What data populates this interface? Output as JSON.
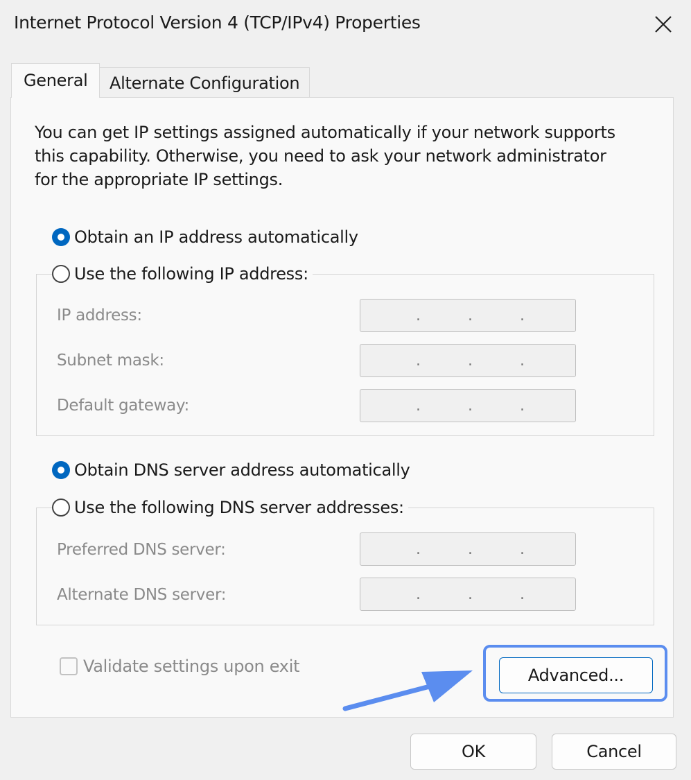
{
  "window": {
    "title": "Internet Protocol Version 4 (TCP/IPv4) Properties",
    "close_icon": "close-icon"
  },
  "tabs": [
    {
      "label": "General",
      "selected": true
    },
    {
      "label": "Alternate Configuration",
      "selected": false
    }
  ],
  "description": [
    "You can get IP settings assigned automatically if your network supports",
    "this capability. Otherwise, you need to ask your network administrator",
    "for the appropriate IP settings."
  ],
  "ip": {
    "auto_label": "Obtain an IP address automatically",
    "auto_selected": true,
    "manual_label": "Use the following IP address:",
    "fields": [
      {
        "label": "IP address:",
        "value": ""
      },
      {
        "label": "Subnet mask:",
        "value": ""
      },
      {
        "label": "Default gateway:",
        "value": ""
      }
    ]
  },
  "dns": {
    "auto_label": "Obtain DNS server address automatically",
    "auto_selected": true,
    "manual_label": "Use the following DNS server addresses:",
    "fields": [
      {
        "label": "Preferred DNS server:",
        "value": ""
      },
      {
        "label": "Alternate DNS server:",
        "value": ""
      }
    ]
  },
  "validate": {
    "label": "Validate settings upon exit",
    "checked": false
  },
  "buttons": {
    "advanced": "Advanced...",
    "ok": "OK",
    "cancel": "Cancel"
  },
  "colors": {
    "accent": "#0067c0",
    "highlight": "#5b8def"
  }
}
